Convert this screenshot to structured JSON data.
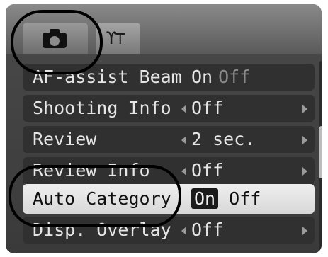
{
  "tabs": [
    {
      "name": "camera-icon"
    },
    {
      "name": "tools-icon"
    }
  ],
  "menu": {
    "items": [
      {
        "label": "AF-assist Beam",
        "value_on": "On",
        "value_off": "Off"
      },
      {
        "label": "Shooting Info",
        "value": "Off"
      },
      {
        "label": "Review",
        "value": "2 sec."
      },
      {
        "label": "Review Info",
        "value": "Off"
      },
      {
        "label": "Auto Category",
        "value_on": "On",
        "value_off": "Off"
      },
      {
        "label": "Disp. Overlay",
        "value": "Off"
      }
    ],
    "selected_label": "Auto Category"
  },
  "colors": {
    "selected_row": "#e6e6e6",
    "row": "#303030",
    "tab_bar": "#7a7a7a"
  }
}
